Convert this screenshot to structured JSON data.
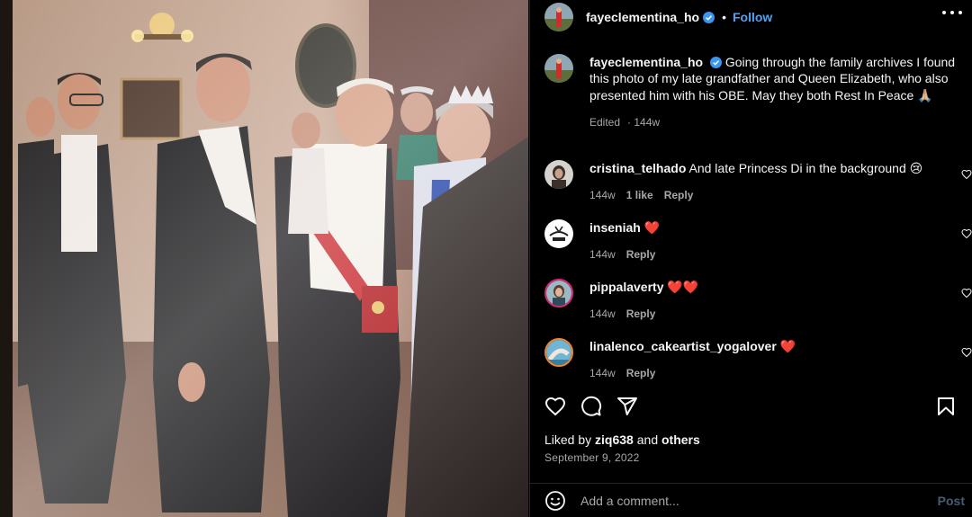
{
  "post": {
    "username": "fayeclementina_ho",
    "verified": true,
    "follow_label": "Follow",
    "separator": "•",
    "more_icon": "more-options-icon",
    "caption": "Going through the family archives I found this photo of my late grandfather and Queen Elizabeth, who also presented him with his OBE. May they both Rest In Peace 🙏🏼",
    "edited_label": "Edited",
    "caption_time": "144w"
  },
  "comments": [
    {
      "username": "cristina_telhado",
      "text": "And late Princess Di in the background 😢",
      "time": "144w",
      "likes": "1 like",
      "reply_label": "Reply"
    },
    {
      "username": "inseniah",
      "text": "❤️",
      "time": "144w",
      "reply_label": "Reply"
    },
    {
      "username": "pippalaverty",
      "text": "❤️❤️",
      "time": "144w",
      "reply_label": "Reply"
    },
    {
      "username": "linalenco_cakeartist_yogalover",
      "text": "❤️",
      "time": "144w",
      "reply_label": "Reply"
    }
  ],
  "actions": {
    "like_icon": "heart-icon",
    "comment_icon": "comment-icon",
    "share_icon": "share-icon",
    "save_icon": "bookmark-icon"
  },
  "likes": {
    "prefix": "Liked by",
    "user": "ziq638",
    "connector": "and",
    "suffix": "others"
  },
  "date": "September 9, 2022",
  "composer": {
    "emoji_icon": "emoji-icon",
    "placeholder": "Add a comment...",
    "post_label": "Post"
  },
  "colors": {
    "background": "#000000",
    "text": "#f5f5f5",
    "secondary": "#a8a8a8",
    "link_blue": "#4ea3f5",
    "verified": "#3897f0",
    "post_disabled": "#4b5a73",
    "divider": "#262626"
  }
}
